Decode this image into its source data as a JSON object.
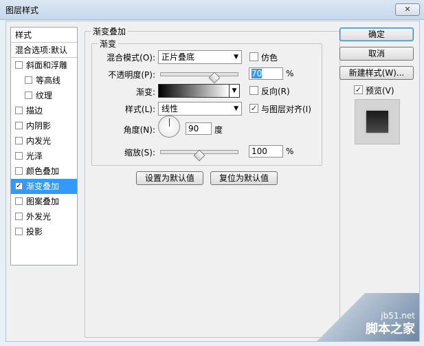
{
  "window": {
    "title": "图层样式",
    "close": "✕"
  },
  "leftlist": {
    "items": [
      {
        "label": "样式",
        "type": "header"
      },
      {
        "label": "混合选项:默认",
        "type": "header"
      },
      {
        "label": "斜面和浮雕",
        "checked": false,
        "indent": 0
      },
      {
        "label": "等高线",
        "checked": false,
        "indent": 1
      },
      {
        "label": "纹理",
        "checked": false,
        "indent": 1
      },
      {
        "label": "描边",
        "checked": false,
        "indent": 0
      },
      {
        "label": "内阴影",
        "checked": false,
        "indent": 0
      },
      {
        "label": "内发光",
        "checked": false,
        "indent": 0
      },
      {
        "label": "光泽",
        "checked": false,
        "indent": 0
      },
      {
        "label": "颜色叠加",
        "checked": false,
        "indent": 0
      },
      {
        "label": "渐变叠加",
        "checked": true,
        "indent": 0,
        "selected": true
      },
      {
        "label": "图案叠加",
        "checked": false,
        "indent": 0
      },
      {
        "label": "外发光",
        "checked": false,
        "indent": 0
      },
      {
        "label": "投影",
        "checked": false,
        "indent": 0
      }
    ]
  },
  "main": {
    "group_title": "渐变叠加",
    "sub_title": "渐变",
    "blend_mode": {
      "label": "混合模式(O):",
      "value": "正片叠底"
    },
    "dither": {
      "label": "仿色",
      "checked": false
    },
    "opacity": {
      "label": "不透明度(P):",
      "value": "70",
      "unit": "%",
      "level": 0.7
    },
    "gradient": {
      "label": "渐变:",
      "colors": [
        "#000000",
        "#ffffff"
      ]
    },
    "reverse": {
      "label": "反向(R)",
      "checked": false
    },
    "style": {
      "label": "样式(L):",
      "value": "线性"
    },
    "align_layer": {
      "label": "与图层对齐(I)",
      "checked": true
    },
    "angle": {
      "label": "角度(N):",
      "value": "90",
      "unit": "度"
    },
    "scale": {
      "label": "缩放(S):",
      "value": "100",
      "unit": "%",
      "level": 0.5
    },
    "btn_default": "设置为默认值",
    "btn_reset": "复位为默认值"
  },
  "right": {
    "ok": "确定",
    "cancel": "取消",
    "new_style": "新建样式(W)...",
    "preview": {
      "label": "预览(V)",
      "checked": true
    }
  },
  "watermark": {
    "site": "jb51.net",
    "brand": "脚本之家"
  }
}
